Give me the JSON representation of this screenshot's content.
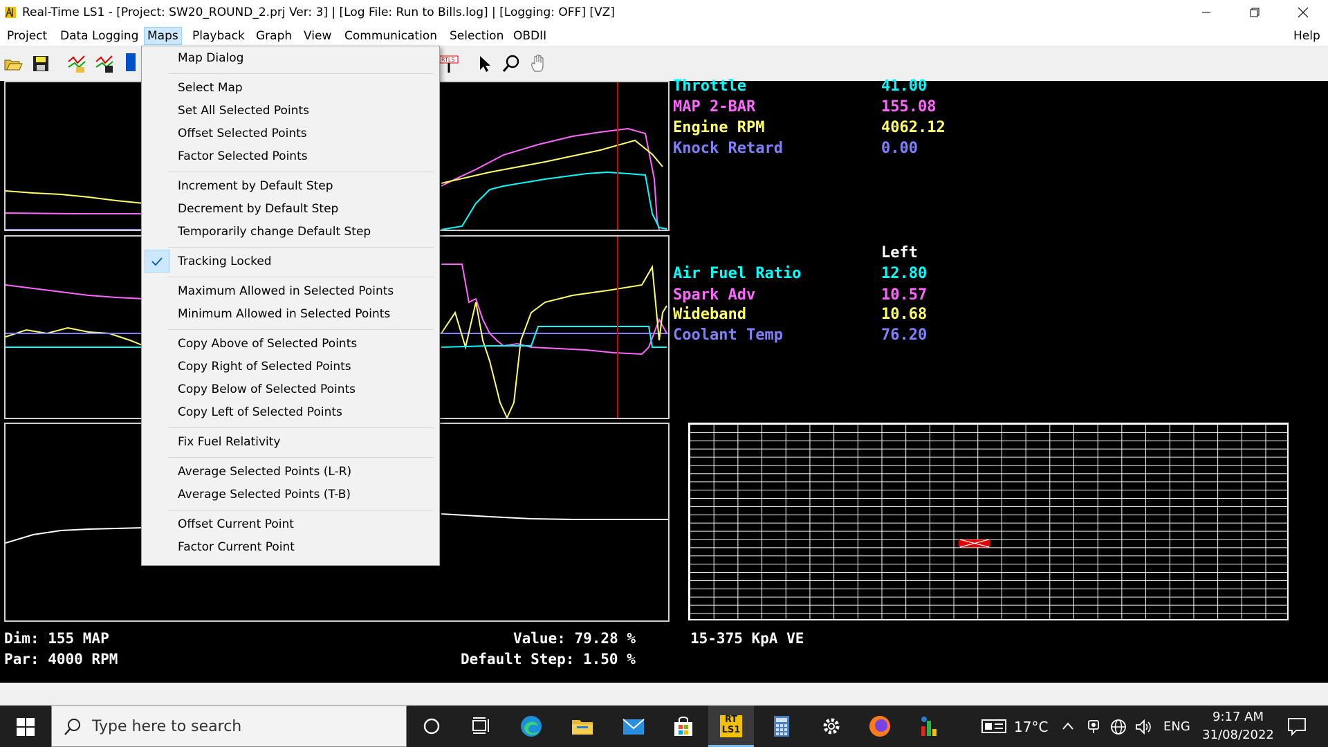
{
  "window": {
    "title": "Real-Time LS1 - [Project: SW20_ROUND_2.prj Ver: 3] | [Log File: Run to Bills.log] | [Logging: OFF] [VZ]"
  },
  "menubar": {
    "items": [
      "Project",
      "Data Logging",
      "Maps",
      "Playback",
      "Graph",
      "View",
      "Communication",
      "Selection",
      "OBDII"
    ],
    "help": "Help",
    "active": "Maps"
  },
  "maps_menu": {
    "groups": [
      [
        "Map Dialog"
      ],
      [
        "Select Map",
        "Set All Selected Points",
        "Offset Selected Points",
        "Factor Selected Points"
      ],
      [
        "Increment by Default Step",
        "Decrement by Default Step",
        "Temporarily change Default Step"
      ],
      [
        "Tracking Locked"
      ],
      [
        "Maximum Allowed in Selected Points",
        "Minimum Allowed in Selected Points"
      ],
      [
        "Copy Above of Selected Points",
        "Copy Right of Selected Points",
        "Copy Below of Selected Points",
        "Copy Left of Selected Points"
      ],
      [
        "Fix Fuel Relativity"
      ],
      [
        "Average Selected Points (L-R)",
        "Average Selected Points (T-B)"
      ],
      [
        "Offset Current Point",
        "Factor Current Point"
      ]
    ],
    "checked": "Tracking Locked"
  },
  "gauges": {
    "top": [
      {
        "label": "Throttle",
        "value": "41.00",
        "color": "#00ffff"
      },
      {
        "label": "MAP 2-BAR",
        "value": "155.08",
        "color": "#ff66ff"
      },
      {
        "label": "Engine RPM",
        "value": "4062.12",
        "color": "#ffff66"
      },
      {
        "label": "Knock Retard",
        "value": "0.00",
        "color": "#8080ff"
      }
    ],
    "column_header": "Left",
    "bottom": [
      {
        "label": "Air Fuel Ratio",
        "value": "12.80",
        "color": "#00ffff"
      },
      {
        "label": "Spark Adv",
        "value": "10.57",
        "color": "#ff66ff"
      },
      {
        "label": "Wideband",
        "value": "10.68",
        "color": "#ffff66"
      },
      {
        "label": "Coolant Temp",
        "value": "76.20",
        "color": "#8080ff"
      }
    ]
  },
  "status": {
    "dim": "Dim:  155 MAP",
    "par": "Par:  4000 RPM",
    "value": "Value: 79.28 %",
    "default_step": "Default Step: 1.50 %",
    "map_name": "15-375 KpA VE"
  },
  "taskbar": {
    "search_placeholder": "Type here to search",
    "weather": "17°C",
    "language": "ENG",
    "time": "9:17 AM",
    "date": "31/08/2022",
    "rt_label_top": "RT",
    "rt_label_bottom": "LS1"
  },
  "colors": {
    "menu_highlight": "#cce8ff",
    "trace_yellow": "#ffff66",
    "trace_magenta": "#ff66ff",
    "trace_cyan": "#00ffff",
    "trace_blue": "#8080ff",
    "cursor_red": "#e00000"
  }
}
